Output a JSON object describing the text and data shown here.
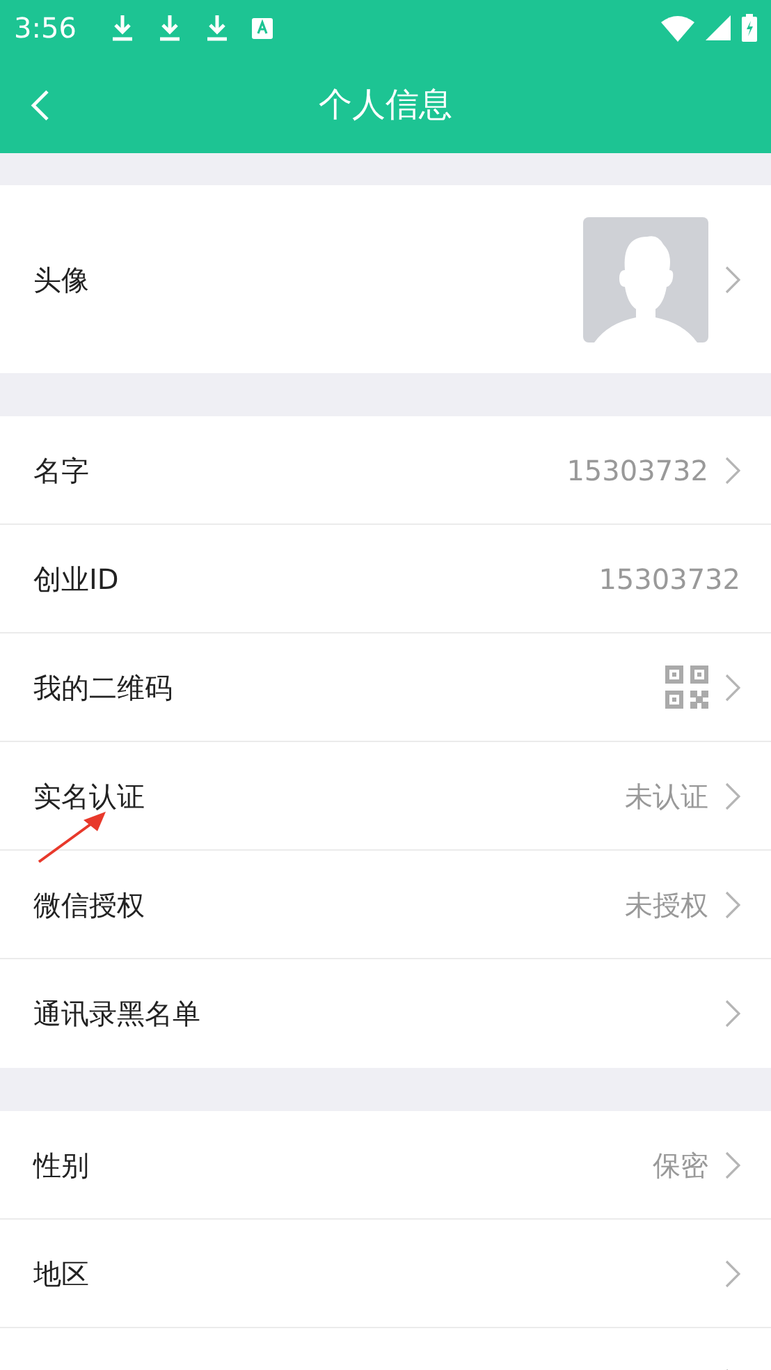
{
  "status_bar": {
    "time": "3:56"
  },
  "header": {
    "title": "个人信息"
  },
  "sections": [
    {
      "rows": [
        {
          "kind": "avatar",
          "label": "头像",
          "chevron": true
        }
      ]
    },
    {
      "rows": [
        {
          "kind": "text",
          "label": "名字",
          "value": "15303732",
          "chevron": true
        },
        {
          "kind": "text",
          "label": "创业ID",
          "value": "15303732",
          "chevron": false
        },
        {
          "kind": "qr",
          "label": "我的二维码",
          "chevron": true
        },
        {
          "kind": "text",
          "label": "实名认证",
          "value": "未认证",
          "chevron": true,
          "annotated": true
        },
        {
          "kind": "text",
          "label": "微信授权",
          "value": "未授权",
          "chevron": true
        },
        {
          "kind": "text",
          "label": "通讯录黑名单",
          "chevron": true
        }
      ]
    },
    {
      "rows": [
        {
          "kind": "text",
          "label": "性别",
          "value": "保密",
          "chevron": true
        },
        {
          "kind": "text",
          "label": "地区",
          "chevron": true
        },
        {
          "kind": "text",
          "chevron": true
        }
      ]
    }
  ]
}
